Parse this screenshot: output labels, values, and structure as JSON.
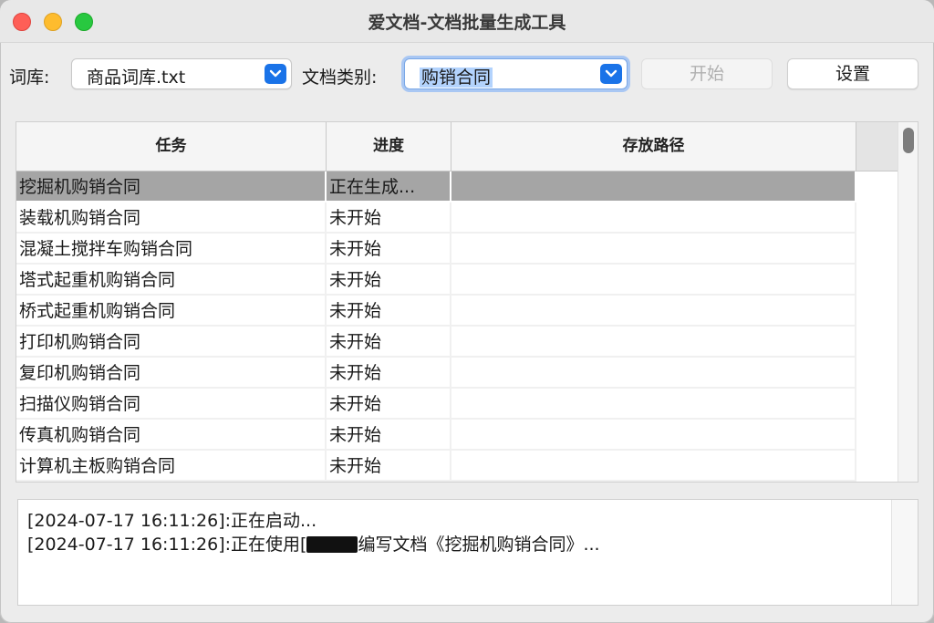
{
  "window": {
    "title": "爱文档-文档批量生成工具"
  },
  "toolbar": {
    "library_label": "词库:",
    "library_value": "商品词库.txt",
    "doctype_label": "文档类别:",
    "doctype_value": "购销合同",
    "start_label": "开始",
    "settings_label": "设置"
  },
  "table": {
    "columns": [
      "任务",
      "进度",
      "存放路径"
    ],
    "rows": [
      {
        "task": "挖掘机购销合同",
        "progress": "正在生成...",
        "path": ""
      },
      {
        "task": "装载机购销合同",
        "progress": "未开始",
        "path": ""
      },
      {
        "task": "混凝土搅拌车购销合同",
        "progress": "未开始",
        "path": ""
      },
      {
        "task": "塔式起重机购销合同",
        "progress": "未开始",
        "path": ""
      },
      {
        "task": "桥式起重机购销合同",
        "progress": "未开始",
        "path": ""
      },
      {
        "task": "打印机购销合同",
        "progress": "未开始",
        "path": ""
      },
      {
        "task": "复印机购销合同",
        "progress": "未开始",
        "path": ""
      },
      {
        "task": "扫描仪购销合同",
        "progress": "未开始",
        "path": ""
      },
      {
        "task": "传真机购销合同",
        "progress": "未开始",
        "path": ""
      },
      {
        "task": "计算机主板购销合同",
        "progress": "未开始",
        "path": ""
      }
    ]
  },
  "log": {
    "line1": "[2024-07-17 16:11:26]:正在启动...",
    "line2_prefix": "[2024-07-17 16:11:26]:正在使用[",
    "line2_suffix": "编写文档《挖掘机购销合同》..."
  },
  "colors": {
    "accent": "#1a73e8",
    "selected_row": "#a5a5a5"
  }
}
